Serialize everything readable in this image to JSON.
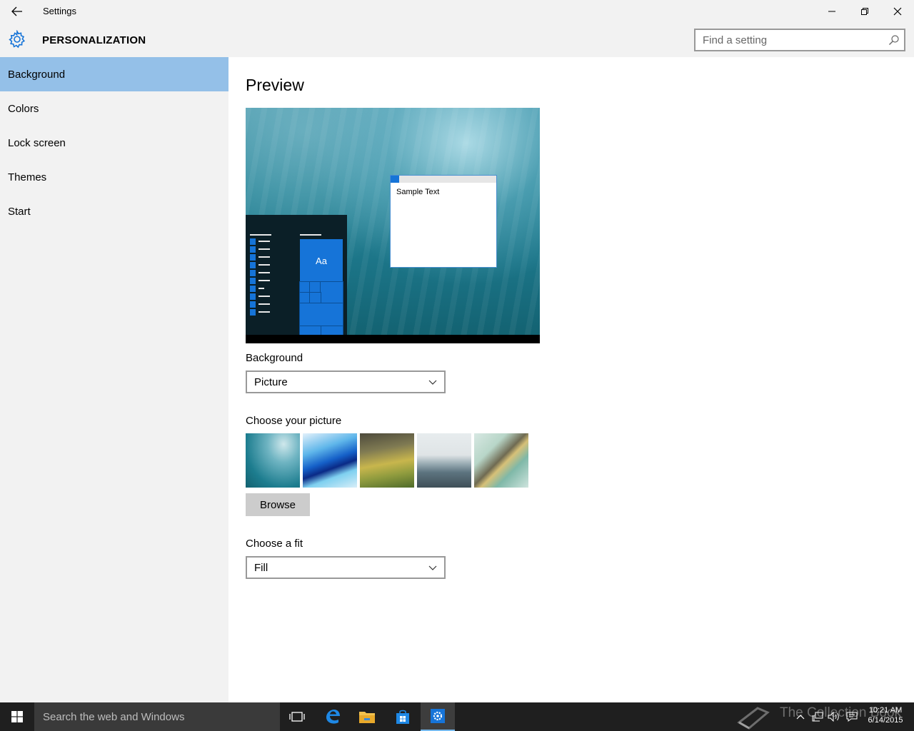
{
  "window": {
    "title": "Settings"
  },
  "header": {
    "section_title": "PERSONALIZATION",
    "search_placeholder": "Find a setting"
  },
  "sidebar": {
    "items": [
      {
        "label": "Background",
        "active": true
      },
      {
        "label": "Colors",
        "active": false
      },
      {
        "label": "Lock screen",
        "active": false
      },
      {
        "label": "Themes",
        "active": false
      },
      {
        "label": "Start",
        "active": false
      }
    ]
  },
  "main": {
    "preview_heading": "Preview",
    "preview_sample_text": "Sample Text",
    "preview_tile_text": "Aa",
    "background_label": "Background",
    "background_value": "Picture",
    "choose_picture_label": "Choose your picture",
    "browse_label": "Browse",
    "fit_label": "Choose a fit",
    "fit_value": "Fill"
  },
  "taskbar": {
    "search_placeholder": "Search the web and Windows",
    "watermark": "The Collection Book",
    "time": "10:21 AM",
    "date": "6/14/2015"
  },
  "colors": {
    "accent": "#1674d8",
    "selected_nav": "#94c0e8",
    "taskbar": "#1f1f1f"
  }
}
